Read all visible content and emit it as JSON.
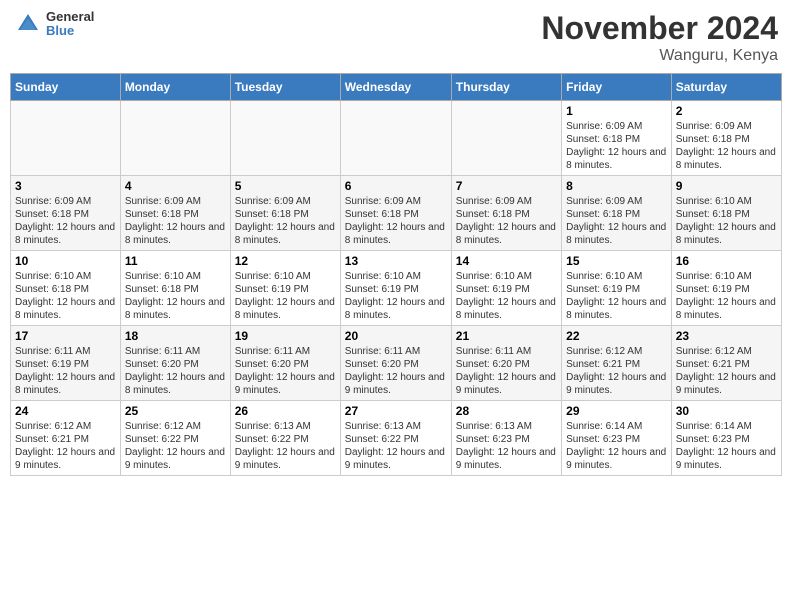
{
  "header": {
    "logo": {
      "general": "General",
      "blue": "Blue"
    },
    "title": "November 2024",
    "location": "Wanguru, Kenya"
  },
  "weekdays": [
    "Sunday",
    "Monday",
    "Tuesday",
    "Wednesday",
    "Thursday",
    "Friday",
    "Saturday"
  ],
  "weeks": [
    [
      {
        "day": "",
        "info": ""
      },
      {
        "day": "",
        "info": ""
      },
      {
        "day": "",
        "info": ""
      },
      {
        "day": "",
        "info": ""
      },
      {
        "day": "",
        "info": ""
      },
      {
        "day": "1",
        "info": "Sunrise: 6:09 AM\nSunset: 6:18 PM\nDaylight: 12 hours and 8 minutes."
      },
      {
        "day": "2",
        "info": "Sunrise: 6:09 AM\nSunset: 6:18 PM\nDaylight: 12 hours and 8 minutes."
      }
    ],
    [
      {
        "day": "3",
        "info": "Sunrise: 6:09 AM\nSunset: 6:18 PM\nDaylight: 12 hours and 8 minutes."
      },
      {
        "day": "4",
        "info": "Sunrise: 6:09 AM\nSunset: 6:18 PM\nDaylight: 12 hours and 8 minutes."
      },
      {
        "day": "5",
        "info": "Sunrise: 6:09 AM\nSunset: 6:18 PM\nDaylight: 12 hours and 8 minutes."
      },
      {
        "day": "6",
        "info": "Sunrise: 6:09 AM\nSunset: 6:18 PM\nDaylight: 12 hours and 8 minutes."
      },
      {
        "day": "7",
        "info": "Sunrise: 6:09 AM\nSunset: 6:18 PM\nDaylight: 12 hours and 8 minutes."
      },
      {
        "day": "8",
        "info": "Sunrise: 6:09 AM\nSunset: 6:18 PM\nDaylight: 12 hours and 8 minutes."
      },
      {
        "day": "9",
        "info": "Sunrise: 6:10 AM\nSunset: 6:18 PM\nDaylight: 12 hours and 8 minutes."
      }
    ],
    [
      {
        "day": "10",
        "info": "Sunrise: 6:10 AM\nSunset: 6:18 PM\nDaylight: 12 hours and 8 minutes."
      },
      {
        "day": "11",
        "info": "Sunrise: 6:10 AM\nSunset: 6:18 PM\nDaylight: 12 hours and 8 minutes."
      },
      {
        "day": "12",
        "info": "Sunrise: 6:10 AM\nSunset: 6:19 PM\nDaylight: 12 hours and 8 minutes."
      },
      {
        "day": "13",
        "info": "Sunrise: 6:10 AM\nSunset: 6:19 PM\nDaylight: 12 hours and 8 minutes."
      },
      {
        "day": "14",
        "info": "Sunrise: 6:10 AM\nSunset: 6:19 PM\nDaylight: 12 hours and 8 minutes."
      },
      {
        "day": "15",
        "info": "Sunrise: 6:10 AM\nSunset: 6:19 PM\nDaylight: 12 hours and 8 minutes."
      },
      {
        "day": "16",
        "info": "Sunrise: 6:10 AM\nSunset: 6:19 PM\nDaylight: 12 hours and 8 minutes."
      }
    ],
    [
      {
        "day": "17",
        "info": "Sunrise: 6:11 AM\nSunset: 6:19 PM\nDaylight: 12 hours and 8 minutes."
      },
      {
        "day": "18",
        "info": "Sunrise: 6:11 AM\nSunset: 6:20 PM\nDaylight: 12 hours and 8 minutes."
      },
      {
        "day": "19",
        "info": "Sunrise: 6:11 AM\nSunset: 6:20 PM\nDaylight: 12 hours and 9 minutes."
      },
      {
        "day": "20",
        "info": "Sunrise: 6:11 AM\nSunset: 6:20 PM\nDaylight: 12 hours and 9 minutes."
      },
      {
        "day": "21",
        "info": "Sunrise: 6:11 AM\nSunset: 6:20 PM\nDaylight: 12 hours and 9 minutes."
      },
      {
        "day": "22",
        "info": "Sunrise: 6:12 AM\nSunset: 6:21 PM\nDaylight: 12 hours and 9 minutes."
      },
      {
        "day": "23",
        "info": "Sunrise: 6:12 AM\nSunset: 6:21 PM\nDaylight: 12 hours and 9 minutes."
      }
    ],
    [
      {
        "day": "24",
        "info": "Sunrise: 6:12 AM\nSunset: 6:21 PM\nDaylight: 12 hours and 9 minutes."
      },
      {
        "day": "25",
        "info": "Sunrise: 6:12 AM\nSunset: 6:22 PM\nDaylight: 12 hours and 9 minutes."
      },
      {
        "day": "26",
        "info": "Sunrise: 6:13 AM\nSunset: 6:22 PM\nDaylight: 12 hours and 9 minutes."
      },
      {
        "day": "27",
        "info": "Sunrise: 6:13 AM\nSunset: 6:22 PM\nDaylight: 12 hours and 9 minutes."
      },
      {
        "day": "28",
        "info": "Sunrise: 6:13 AM\nSunset: 6:23 PM\nDaylight: 12 hours and 9 minutes."
      },
      {
        "day": "29",
        "info": "Sunrise: 6:14 AM\nSunset: 6:23 PM\nDaylight: 12 hours and 9 minutes."
      },
      {
        "day": "30",
        "info": "Sunrise: 6:14 AM\nSunset: 6:23 PM\nDaylight: 12 hours and 9 minutes."
      }
    ]
  ]
}
